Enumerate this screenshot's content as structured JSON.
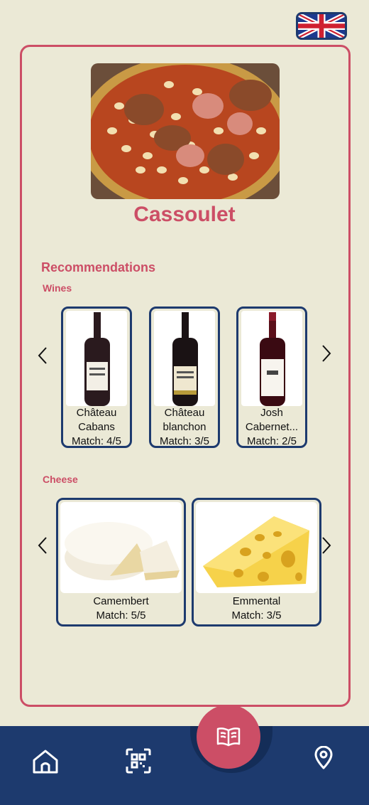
{
  "language": {
    "flag": "uk-flag-icon"
  },
  "dish": {
    "title": "Cassoulet",
    "image": "cassoulet-dish-image"
  },
  "recommendations": {
    "title": "Recommendations",
    "wines_label": "Wines",
    "cheese_label": "Cheese",
    "wines": [
      {
        "name_line1": "Château",
        "name_line2": "Cabans",
        "match": "Match: 4/5",
        "image": "wine-bottle-image"
      },
      {
        "name_line1": "Château",
        "name_line2": "blanchon",
        "match": "Match: 3/5",
        "image": "wine-bottle-image"
      },
      {
        "name_line1": "Josh",
        "name_line2": "Cabernet...",
        "match": "Match: 2/5",
        "image": "wine-bottle-image"
      }
    ],
    "cheeses": [
      {
        "name": "Camembert",
        "match": "Match: 5/5",
        "image": "camembert-image"
      },
      {
        "name": "Emmental",
        "match": "Match: 3/5",
        "image": "emmental-image"
      }
    ]
  },
  "nav": {
    "items": [
      "home-icon",
      "qr-scan-icon",
      "book-icon",
      "location-pin-icon"
    ],
    "active": "book-icon"
  },
  "colors": {
    "background": "#ebe9d6",
    "accent": "#cc4e66",
    "navy": "#1d3a6e"
  }
}
